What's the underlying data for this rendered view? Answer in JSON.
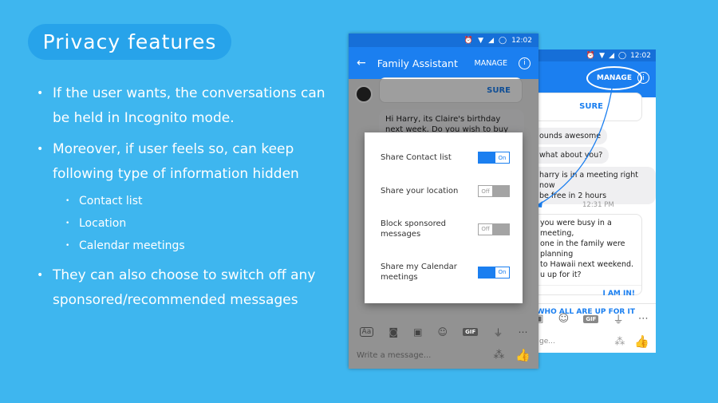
{
  "slide": {
    "title": "Privacy features",
    "bullet1": "If the user wants, the conversations can be held in Incognito mode.",
    "bullet2": "Moreover, if user feels so, can keep following type of information hidden",
    "sub_items": [
      "Contact list",
      "Location",
      "Calendar meetings"
    ],
    "bullet3": "They can also choose to switch off any sponsored/recommended messages"
  },
  "front_phone": {
    "time": "12:02",
    "title": "Family Assistant",
    "manage_label": "MANAGE",
    "sure_label": "SURE",
    "claire_message": "Hi Harry, its Claire's birthday next week. Do you wish to buy her a gift?",
    "settings": [
      {
        "label": "Share Contact list",
        "state": "On"
      },
      {
        "label": "Share your location",
        "state": "Off"
      },
      {
        "label": "Block sponsored messages",
        "state": "Off"
      },
      {
        "label": "Share my Calendar meetings",
        "state": "On"
      }
    ],
    "compose_placeholder": "Write a message...",
    "aa_label": "Aa",
    "gif_label": "GIF"
  },
  "back_phone": {
    "time": "12:02",
    "manage_label": "MANAGE",
    "sure_label": "SURE",
    "msg_sounds": "ounds awesome",
    "msg_what": "what about you?",
    "msg_meeting": "harry is in a meeting right now\nbe free in 2 hours",
    "timestamp": "12:31 PM",
    "msg_hawaii": "you were busy in a meeting,\none in the family were planning\nto Hawaii next weekend.\nu up for it?",
    "link1": "I AM IN!",
    "link2": "WHO ALL ARE UP FOR IT",
    "compose_fragment": "ge...",
    "gif_label": "GIF"
  },
  "colors": {
    "background": "#3eb6ef",
    "title_pill": "#27a3ea",
    "app_blue": "#1b7ff0"
  }
}
